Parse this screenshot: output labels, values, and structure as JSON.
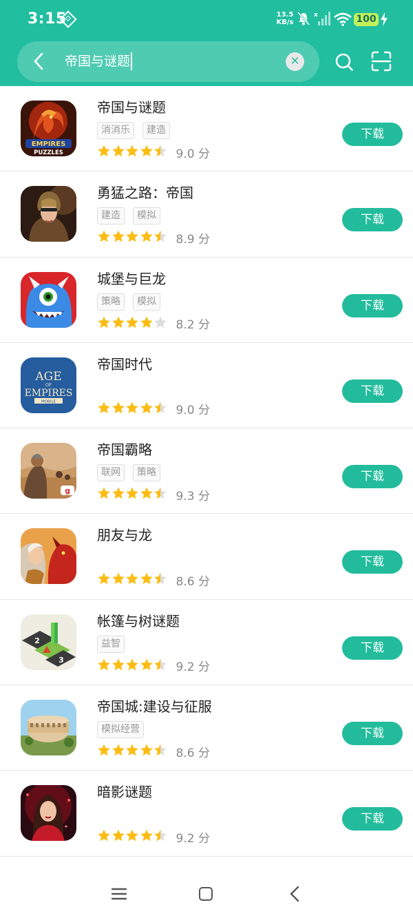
{
  "status_bar": {
    "time": "3:15",
    "net_speed_value": "13.5",
    "net_speed_unit": "KB/s",
    "battery": "100"
  },
  "search": {
    "query": "帝国与谜题"
  },
  "colors": {
    "accent": "#21bea0",
    "button": "#22bc9c",
    "star": "#fcbc12",
    "star_empty": "#dddddd"
  },
  "apps": [
    {
      "name": "帝国与谜题",
      "tags": [
        "消消乐",
        "建造"
      ],
      "stars": 4.5,
      "score": "9.0 分",
      "download": "下载"
    },
    {
      "name": "勇猛之路：帝国",
      "tags": [
        "建造",
        "模拟"
      ],
      "stars": 4.5,
      "score": "8.9 分",
      "download": "下载"
    },
    {
      "name": "城堡与巨龙",
      "tags": [
        "策略",
        "模拟"
      ],
      "stars": 4,
      "score": "8.2 分",
      "download": "下载"
    },
    {
      "name": "帝国时代",
      "tags": [],
      "stars": 4.5,
      "score": "9.0 分",
      "download": "下载"
    },
    {
      "name": "帝国霸略",
      "tags": [
        "联网",
        "策略"
      ],
      "stars": 4.5,
      "score": "9.3 分",
      "download": "下载"
    },
    {
      "name": "朋友与龙",
      "tags": [],
      "stars": 4.5,
      "score": "8.6 分",
      "download": "下载"
    },
    {
      "name": "帐篷与树谜题",
      "tags": [
        "益智"
      ],
      "stars": 4.5,
      "score": "9.2 分",
      "download": "下载"
    },
    {
      "name": "帝国城:建设与征服",
      "tags": [
        "模拟经营"
      ],
      "stars": 4.5,
      "score": "8.6 分",
      "download": "下载"
    },
    {
      "name": "暗影谜题",
      "tags": [],
      "stars": 4.5,
      "score": "9.2 分",
      "download": "下载"
    }
  ],
  "icon_text": {
    "empires_1": "EMPIRES",
    "empires_2": "PUZZLES",
    "age_1": "AGE",
    "age_2": "EMPIRES",
    "age_of": "OF",
    "age_mobile": "MOBILE",
    "tent_n1": "2",
    "tent_n2": "3"
  }
}
